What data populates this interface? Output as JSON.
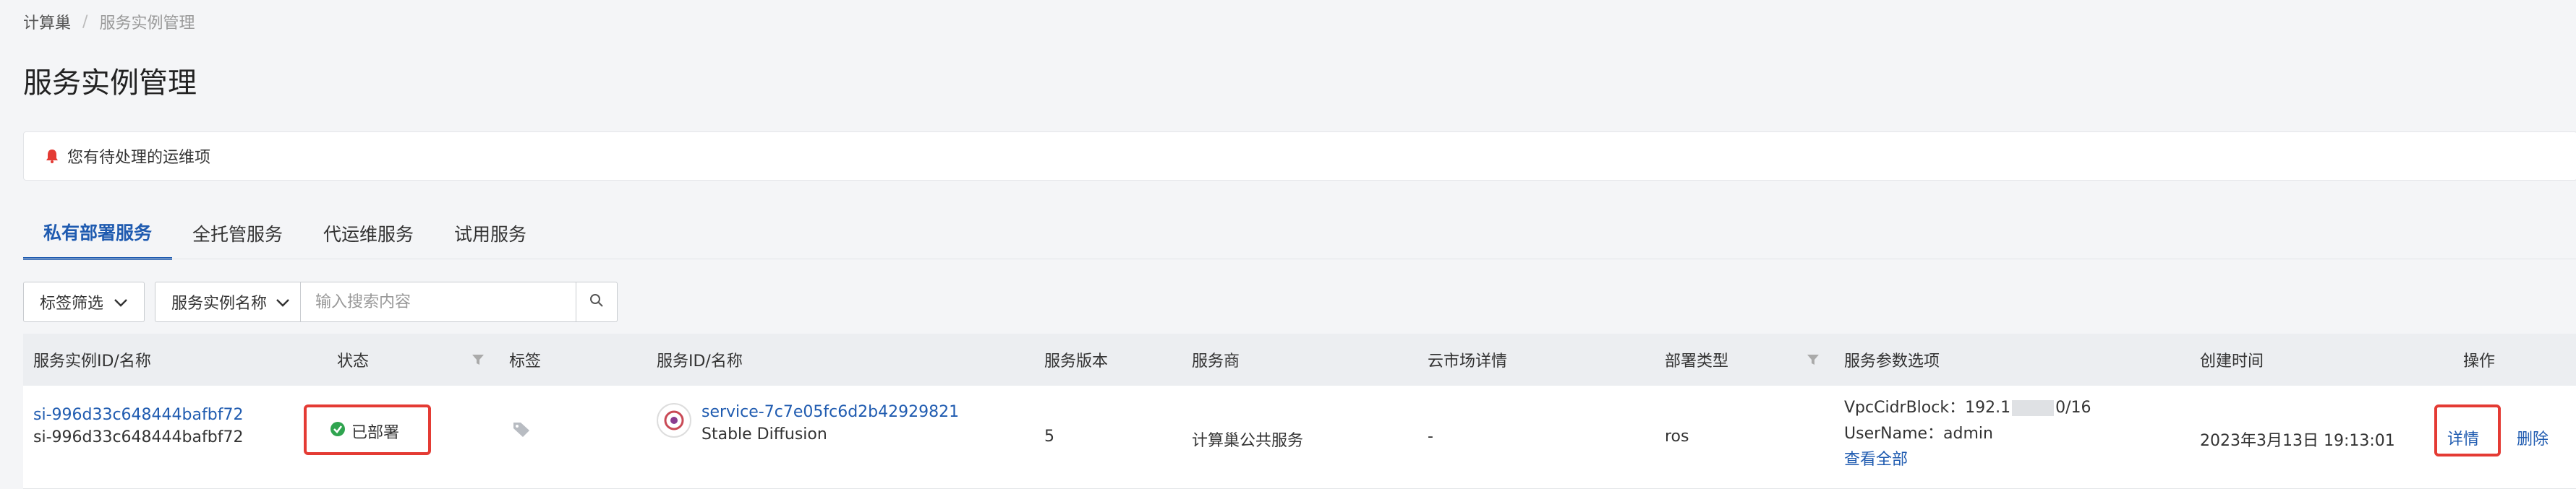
{
  "breadcrumb": {
    "root": "计算巢",
    "current": "服务实例管理"
  },
  "page_title": "服务实例管理",
  "notice": {
    "text": "您有待处理的运维项"
  },
  "tabs": [
    {
      "label": "私有部署服务",
      "active": true
    },
    {
      "label": "全托管服务",
      "active": false
    },
    {
      "label": "代运维服务",
      "active": false
    },
    {
      "label": "试用服务",
      "active": false
    }
  ],
  "filters": {
    "tag_filter_label": "标签筛选",
    "search_field_label": "服务实例名称",
    "search_placeholder": "输入搜索内容",
    "search_value": ""
  },
  "table": {
    "headers": {
      "instance": "服务实例ID/名称",
      "status": "状态",
      "tags": "标签",
      "service": "服务ID/名称",
      "version": "服务版本",
      "provider": "服务商",
      "marketplace": "云市场详情",
      "deploy_type": "部署类型",
      "params": "服务参数选项",
      "created": "创建时间",
      "actions": "操作"
    },
    "rows": [
      {
        "instance_id": "si-996d33c648444bafbf72",
        "instance_name": "si-996d33c648444bafbf72",
        "status": "已部署",
        "service_id": "service-7c7e05fc6d2b42929821",
        "service_name": "Stable Diffusion",
        "version": "5",
        "provider": "计算巢公共服务",
        "marketplace": "-",
        "deploy_type": "ros",
        "params": {
          "vpc_label": "VpcCidrBlock：",
          "vpc_prefix": "192.1",
          "vpc_suffix": "0/16",
          "username": "UserName：admin",
          "view_all": "查看全部"
        },
        "created": "2023年3月13日 19:13:01",
        "action_detail": "详情",
        "action_delete": "删除"
      }
    ]
  },
  "colors": {
    "accent": "#1f5bb0",
    "success": "#2fa44f",
    "highlight": "#e43b34",
    "bell": "#e43b34"
  }
}
